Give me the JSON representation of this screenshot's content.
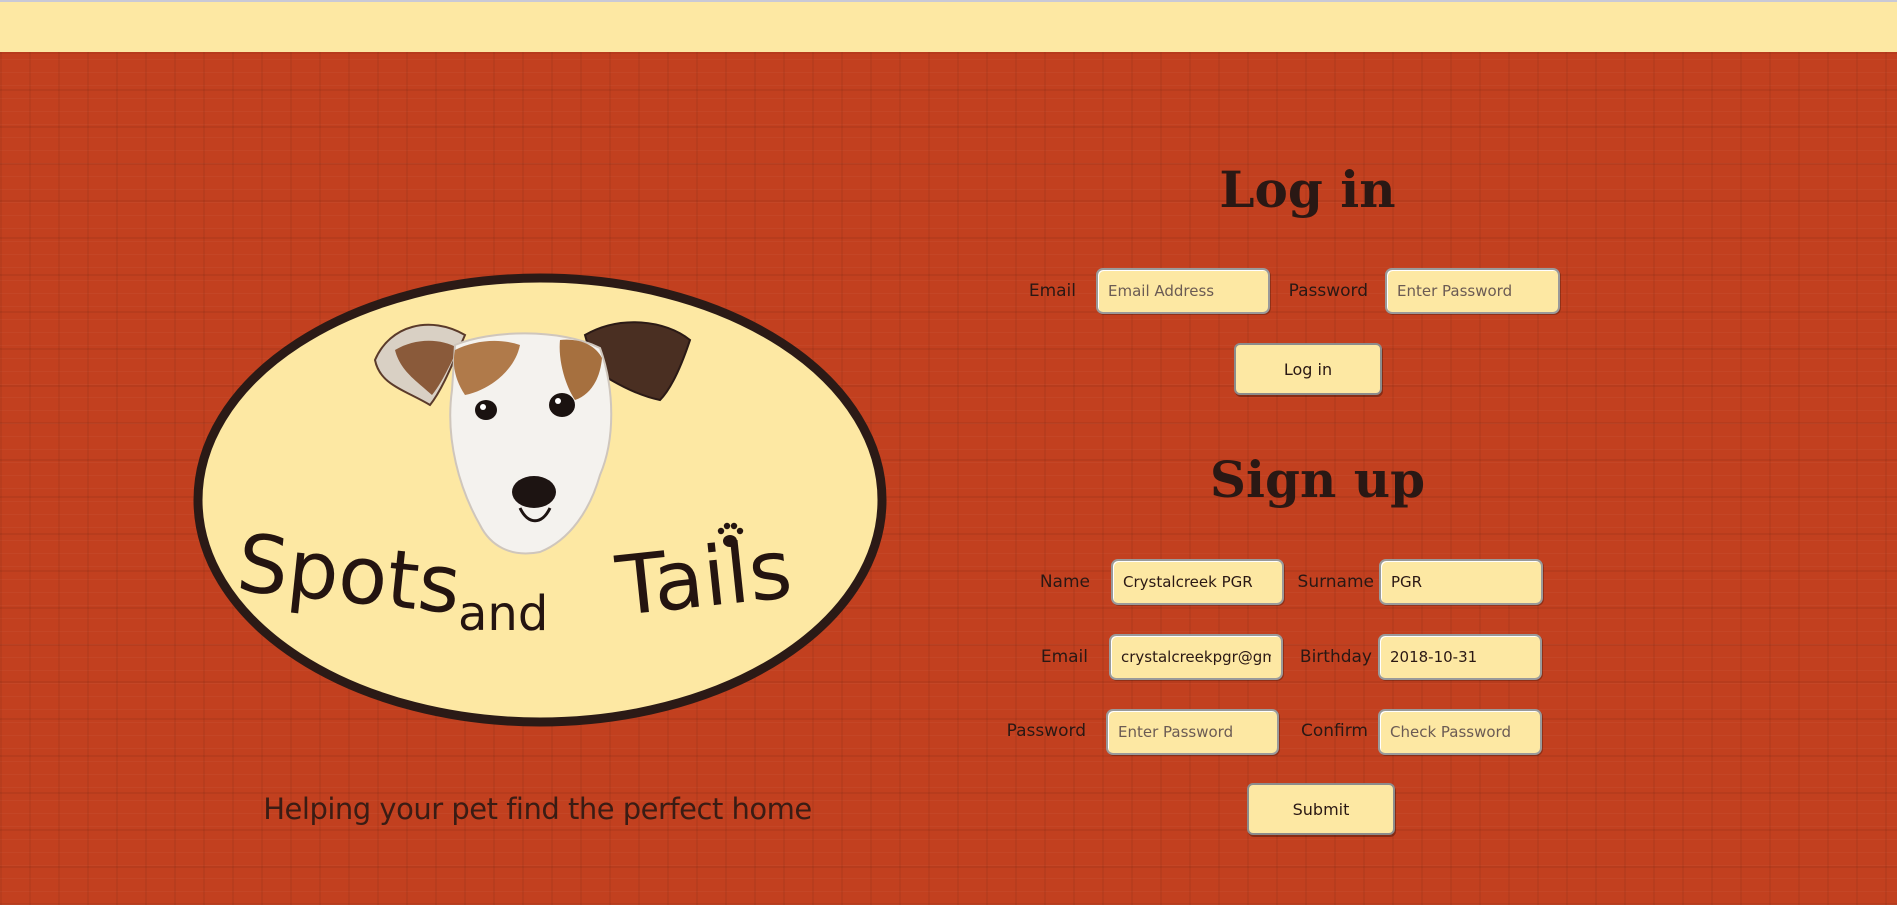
{
  "branding": {
    "logo_text_spots": "Spots",
    "logo_text_and": "and",
    "logo_text_tails": "Tails",
    "tagline": "Helping your pet find the perfect home"
  },
  "login": {
    "heading": "Log in",
    "email_label": "Email",
    "email_placeholder": "Email Address",
    "email_value": "",
    "password_label": "Password",
    "password_placeholder": "Enter Password",
    "password_value": "",
    "submit_label": "Log in"
  },
  "signup": {
    "heading": "Sign up",
    "name_label": "Name",
    "name_value": "Crystalcreek PGR",
    "surname_label": "Surname",
    "surname_value": "PGR",
    "email_label": "Email",
    "email_value": "crystalcreekpgr@gma",
    "birthday_label": "Birthday",
    "birthday_value": "2018-10-31",
    "password_label": "Password",
    "password_placeholder": "Enter Password",
    "password_value": "",
    "confirm_label": "Confirm",
    "confirm_placeholder": "Check Password",
    "confirm_value": "",
    "submit_label": "Submit"
  },
  "colors": {
    "background": "#c2401f",
    "cream": "#fde8a3",
    "text_dark": "#2a1814"
  },
  "icons": [
    "dog-head-image",
    "paw-icon"
  ]
}
